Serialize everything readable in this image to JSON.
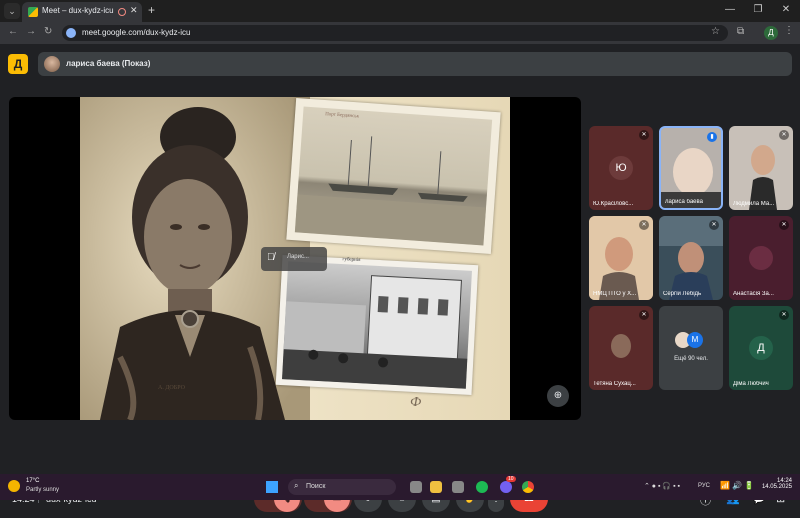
{
  "browser": {
    "tab_title": "Meet – dux-kydz-icu",
    "url": "meet.google.com/dux-kydz-icu",
    "profile_initial": "Д"
  },
  "meet": {
    "logo_letter": "Д",
    "presenter_label": "лариса баева (Показ)",
    "slide": {
      "photo1_caption": "Порт Бердянськ",
      "photo2_caption": "губернія",
      "bottom_text": "Ф",
      "left_caption": "А. ДОБРО"
    },
    "floating_tile_name": "Ларис...",
    "tiles": [
      {
        "name": "Ю.Красіловс...",
        "avatar": "Ю",
        "muted": true,
        "bg": "#5a2a2a",
        "avatar_bg": "#6d3b3b",
        "type": "avatar"
      },
      {
        "name": "лариса баева",
        "avatar": "",
        "muted": false,
        "bg": "#b7b1ac",
        "avatar_bg": "",
        "type": "video"
      },
      {
        "name": "Людмила Ма...",
        "avatar": "",
        "muted": true,
        "bg": "#c8c0b8",
        "avatar_bg": "",
        "type": "video"
      },
      {
        "name": "НМЦ ПТО у Х...",
        "avatar": "",
        "muted": true,
        "bg": "#d4a47a",
        "avatar_bg": "",
        "type": "video"
      },
      {
        "name": "Сергій Лебідь",
        "avatar": "",
        "muted": true,
        "bg": "#3a4e5a",
        "avatar_bg": "",
        "type": "video"
      },
      {
        "name": "Анастасія За...",
        "avatar": "",
        "muted": true,
        "bg": "#4a1e2e",
        "avatar_bg": "#6b2d42",
        "type": "avatar-photo"
      },
      {
        "name": "Тетяна Сухац...",
        "avatar": "",
        "muted": true,
        "bg": "#5a2a2a",
        "avatar_bg": "",
        "type": "video-dark"
      },
      {
        "name": "",
        "avatar": "M",
        "muted": false,
        "bg": "#3c4043",
        "avatar_bg": "#1a73e8",
        "type": "more"
      },
      {
        "name": "Діма Любчич",
        "avatar": "Д",
        "muted": false,
        "bg": "#1e4a3a",
        "avatar_bg": "#24624a",
        "type": "avatar"
      }
    ],
    "more_tile_text": "Ещё 90 чел.",
    "bottom": {
      "time": "14:24",
      "code": "dux-kydz-icu",
      "participants_badge": "99"
    }
  },
  "taskbar": {
    "weather_temp": "17°C",
    "weather_desc": "Partly sunny",
    "search_label": "Поиск",
    "lang": "РУС",
    "time": "14:24",
    "date": "14.05.2025",
    "notif_badge": "10"
  },
  "colors": {
    "accent": "#8ab4f8",
    "hangup": "#ea4335",
    "muted_red": "#f28b82",
    "meet_bg": "#202124"
  }
}
